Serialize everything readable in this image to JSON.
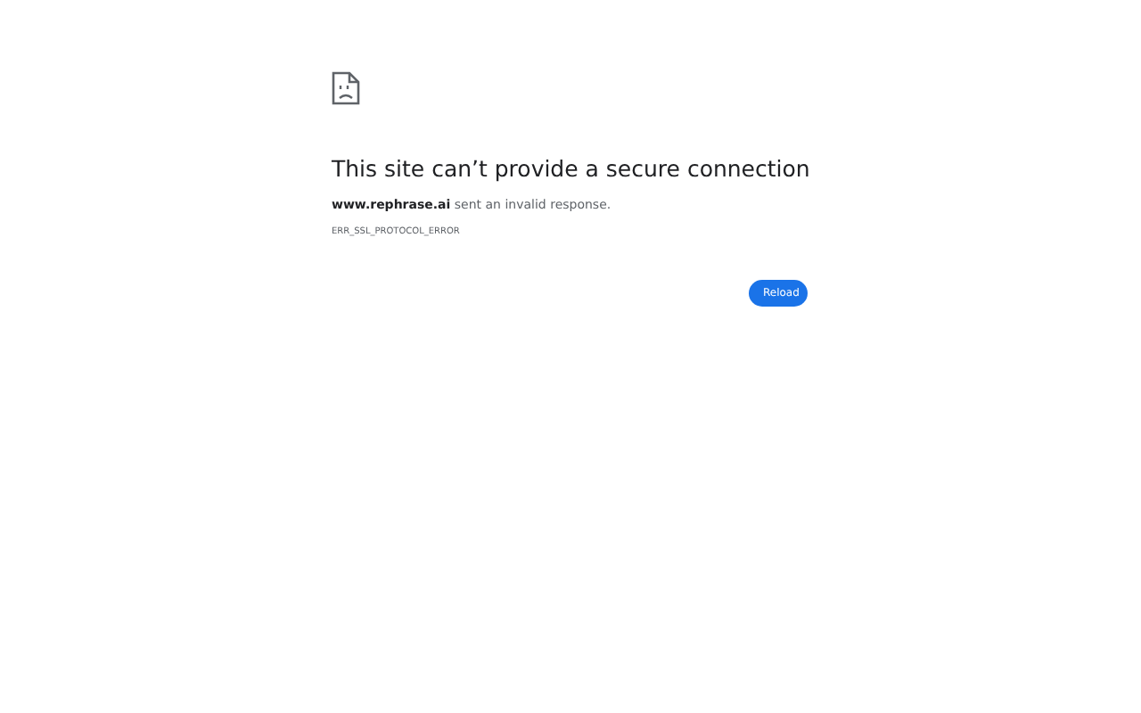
{
  "title": "This site can’t provide a secure connection",
  "message": "**www.rephrase.ai** sent an invalid response.",
  "error_code": "ERR_SSL_PROTOCOL_ERROR",
  "buttons": [
    "Reload"
  ]
}
